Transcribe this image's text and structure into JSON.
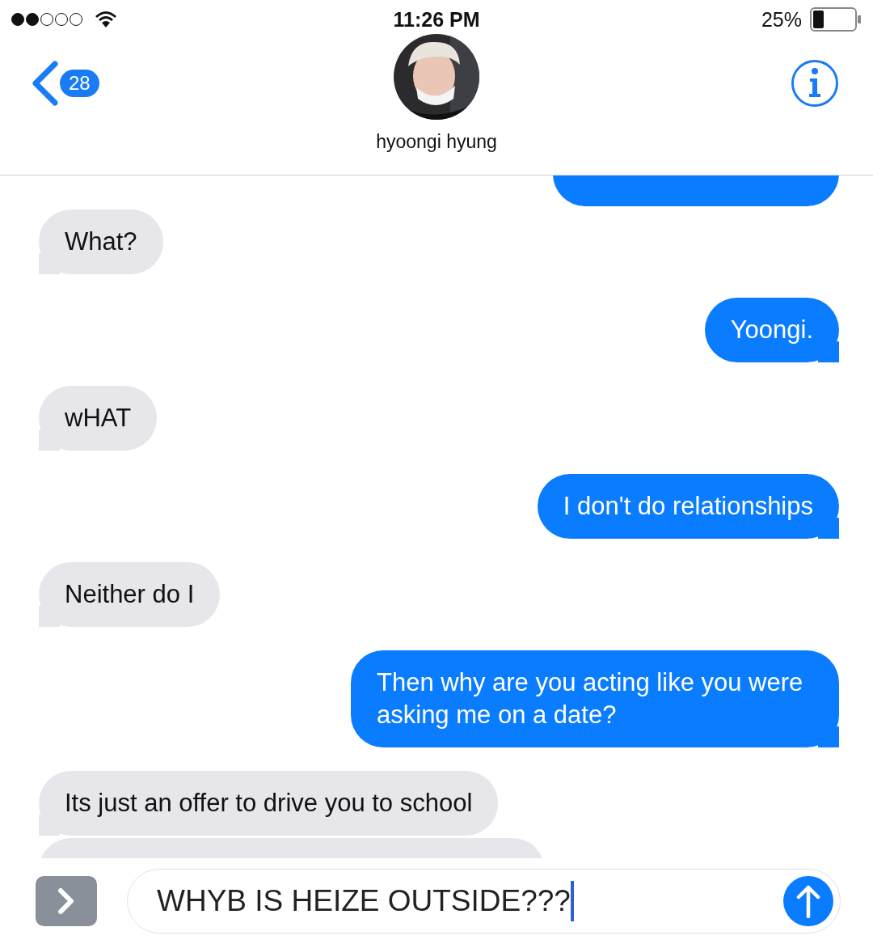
{
  "status_bar": {
    "time": "11:26 PM",
    "battery": "25%"
  },
  "header": {
    "back_badge": "28",
    "contact_name": "hyoongi hyung"
  },
  "messages": [
    {
      "outgoing": true
    },
    {
      "text": "What?",
      "outgoing": false
    },
    {
      "text": "Yoongi.",
      "outgoing": true
    },
    {
      "text": "wHAT",
      "outgoing": false
    },
    {
      "text": "I don't do relationships",
      "outgoing": true
    },
    {
      "text": "Neither do I",
      "outgoing": false
    },
    {
      "text": "Then why are you acting like you were asking me on a date?",
      "outgoing": true
    },
    {
      "text": "Its just an offer to drive you to school",
      "outgoing": false
    },
    {
      "outgoing": false
    }
  ],
  "composer": {
    "value": "WHYB IS HEIZE OUTSIDE???"
  }
}
